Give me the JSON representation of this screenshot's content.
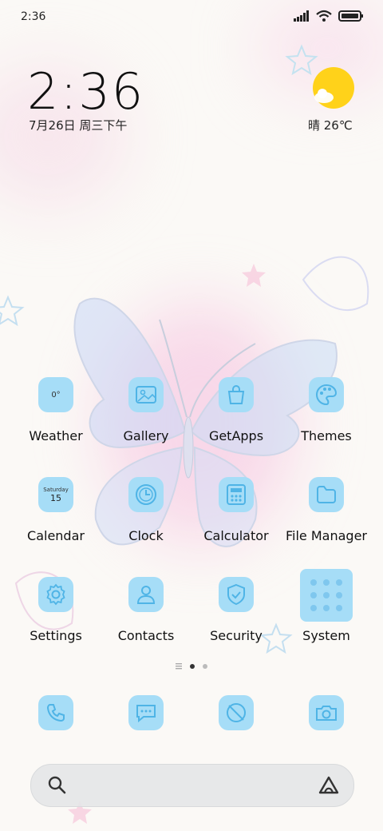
{
  "statusbar": {
    "time": "2:36"
  },
  "lockclock": {
    "time": "2:36",
    "date": "7月26日 周三下午"
  },
  "weather": {
    "text": "晴 26℃",
    "icon": "sun-cloud-icon"
  },
  "apps": [
    {
      "label": "Weather",
      "icon": "weather-icon",
      "sub": "0°"
    },
    {
      "label": "Gallery",
      "icon": "gallery-icon"
    },
    {
      "label": "GetApps",
      "icon": "shopping-bag-icon"
    },
    {
      "label": "Themes",
      "icon": "palette-icon"
    },
    {
      "label": "Calendar",
      "icon": "calendar-icon",
      "sub": "Saturday",
      "day": "15"
    },
    {
      "label": "Clock",
      "icon": "clock-icon"
    },
    {
      "label": "Calculator",
      "icon": "calculator-icon"
    },
    {
      "label": "File Manager",
      "icon": "folder-icon"
    },
    {
      "label": "Settings",
      "icon": "gear-icon"
    },
    {
      "label": "Contacts",
      "icon": "person-icon"
    },
    {
      "label": "Security",
      "icon": "shield-icon"
    },
    {
      "label": "System",
      "icon": "folder-grid-icon"
    }
  ],
  "dock": [
    "phone-icon",
    "messages-icon",
    "browser-icon",
    "camera-icon"
  ],
  "colors": {
    "icon_bg": "#a6ddf7",
    "icon_line": "#4fb4e6",
    "sun": "#ffd21a"
  }
}
